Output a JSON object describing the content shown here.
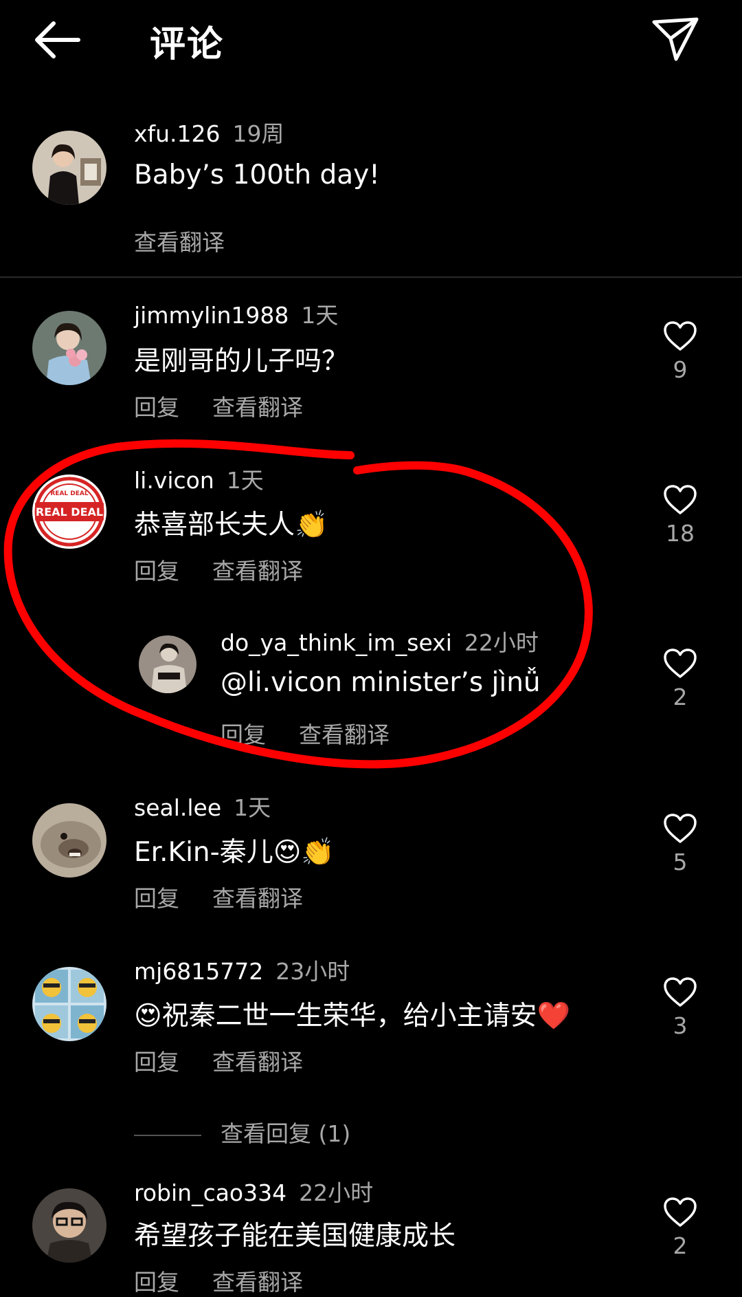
{
  "header": {
    "title": "评论"
  },
  "colors": {
    "background": "#000000",
    "text": "#ffffff",
    "muted": "#a8a8a8",
    "annotation": "#ff0000"
  },
  "caption": {
    "username": "xfu.126",
    "time": "19周",
    "text": "Baby’s 100th day!",
    "translate": "查看翻译"
  },
  "comments": [
    {
      "username": "jimmylin1988",
      "time": "1天",
      "text": "是刚哥的儿子吗？",
      "reply": "回复",
      "translate": "查看翻译",
      "likes": "9"
    },
    {
      "username": "li.vicon",
      "time": "1天",
      "text": "恭喜部长夫人👏",
      "reply": "回复",
      "translate": "查看翻译",
      "likes": "18",
      "avatar_text": [
        "REAL DEAL",
        "REAL DEAL"
      ]
    },
    {
      "username": "do_ya_think_im_sexi",
      "time": "22小时",
      "text": "@li.vicon minister’s jìnǚ",
      "reply": "回复",
      "translate": "查看翻译",
      "likes": "2"
    },
    {
      "username": "seal.lee",
      "time": "1天",
      "text": "Er.Kin-秦儿😍👏",
      "reply": "回复",
      "translate": "查看翻译",
      "likes": "5"
    },
    {
      "username": "mj6815772",
      "time": "23小时",
      "text": "😍祝秦二世一生荣华，给小主请安❤️",
      "reply": "回复",
      "translate": "查看翻译",
      "likes": "3"
    },
    {
      "username": "robin_cao334",
      "time": "22小时",
      "text": "希望孩子能在美国健康成长",
      "reply": "回复",
      "translate": "查看翻译",
      "likes": "2"
    }
  ],
  "view_replies": "查看回复 (1)",
  "icons": {
    "back": "arrow-left-icon",
    "send": "send-icon",
    "like": "heart-icon"
  }
}
